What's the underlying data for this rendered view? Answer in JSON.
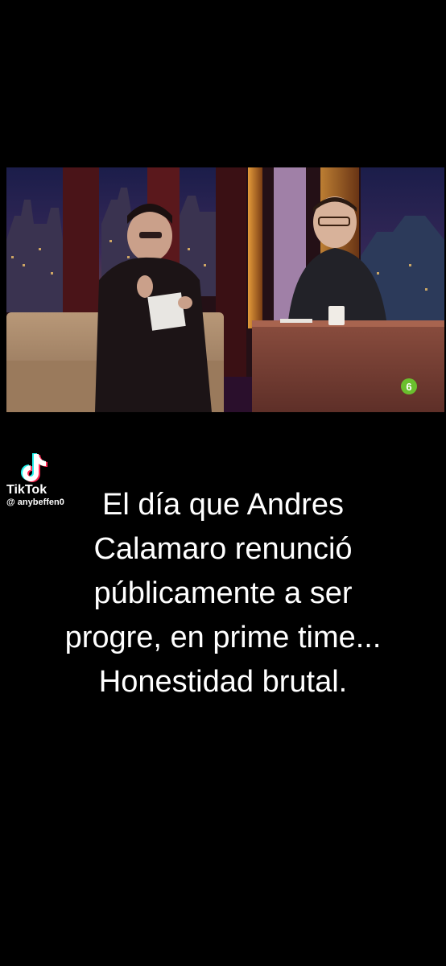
{
  "video": {
    "description_icon": "talk-show-still",
    "channel_logo_icon": "lasexta-logo-icon"
  },
  "watermark": {
    "brand": "TikTok",
    "handle": "@ anybeffen0",
    "logo_icon": "tiktok-note-icon"
  },
  "caption": {
    "lines": [
      "El día que Andres",
      "Calamaro renunció",
      "públicamente a ser",
      "progre, en prime time...",
      "Honestidad brutal."
    ]
  },
  "colors": {
    "background": "#000000",
    "text": "#ffffff",
    "tiktok_cyan": "#25F4EE",
    "tiktok_red": "#FE2C55",
    "channel_green": "#6abf2e"
  }
}
